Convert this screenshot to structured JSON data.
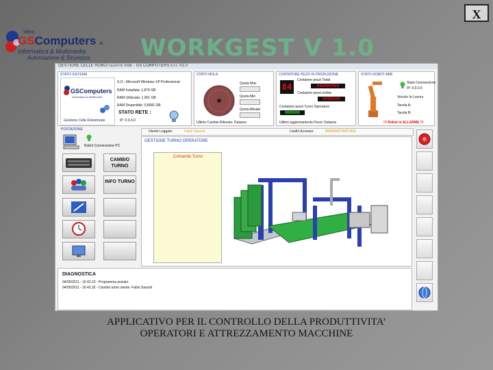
{
  "window": {
    "close_label": "X"
  },
  "logo": {
    "tiny": "Vero",
    "brand_left": "GS",
    "brand_right": "Computers",
    "suffix": "sl",
    "line1": "Informatica & Multimedia",
    "line2": "Automazione & Sicurezza"
  },
  "title": "WORKGEST V 1.0",
  "app": {
    "titlebar": "GESTIONE CELLE ROBOTIZZATE  ASE - GS COMPUTERS s.r.l. V1.0",
    "stato_sistema": {
      "title": "STATO SISTEMA",
      "logo_brand": "GSComputers",
      "logo_sub": "Informatica & Multimedia",
      "so": "S.O.:   Microsoft Windows XP Professional",
      "ram_inst": "RAM Installata: 1,879 GB",
      "ram_util": "RAM Utilizzata: 1,001 GB",
      "ram_disp": "RAM Disponibile: 0,8681 GB",
      "stato_rete": "STATO RETE :",
      "ip": "IP:  0.0.0.0",
      "caption": "Gestione Celle Robotizzate"
    },
    "stato_mola": {
      "title": "STATO MOLA",
      "quota_max": "Quota Max",
      "quota_min": "Quota Min",
      "quota_attuale": "Quota Attuale",
      "ultimo_cambio": "Ultimo Cambio Rilevato: Dataora"
    },
    "contatore": {
      "title": "CONTATORE PEZZI DI PRODUZIONE",
      "counter_big": "84",
      "label_totali": "Contatore pezzi Totali",
      "val_totali": "000000000",
      "label_ordine": "Contatore pezzi ordine",
      "val_ordine": "0000000",
      "label_turno": "Contatore pezzi Turno Operatore",
      "val_turno": "000000",
      "footer": "Ultimo aggiornamento Pezzi: Dataora"
    },
    "stato_robot": {
      "title": "STATO ROBOT ABB",
      "stato_connessione": "Stato Connessione",
      "ip": "IP:  0.0.0.0",
      "veicolo": "Veicolo In Lavoro",
      "tavola_a": "Tavola A:",
      "tavola_b": "Tavola B:",
      "allarme": "!!! Robot in ALLARME !!!"
    },
    "postazione": {
      "title": "POSTAZIONE",
      "pc_label": "Robot Connessione PC"
    },
    "side_buttons": {
      "cambio": "CAMBIO TURNO",
      "info": "INFO TURNO"
    },
    "operator_bar": {
      "utente_label": "Utente Loggato:",
      "utente_value": "Fabio Sassoli",
      "livello_label": "Livello Accesso:",
      "livello_value": "AMMINISTRATORE"
    },
    "gestione": {
      "title": "GESTIONE TURNO OPERATORE",
      "comande_label": "Comande Turno"
    },
    "diagnostica": {
      "title": "DIAGNOSTICA",
      "line1": "04/05/2011 - 16.42.10 - Programma avviato",
      "line2": "04/05/2011 - 16.42.32 - Cambio turno utente: Fabio Sassoli"
    }
  },
  "footer": {
    "line1": "APPLICATIVO PER IL CONTROLLO DELLA PRODUTTIVITA’",
    "line2": "OPERATORI E ATTREZZAMENTO MACCHINE"
  },
  "colors": {
    "title": "#6cb08a",
    "header_blue": "#2040a0",
    "alarm_red": "#e01010",
    "counter_green": "#20e020"
  }
}
